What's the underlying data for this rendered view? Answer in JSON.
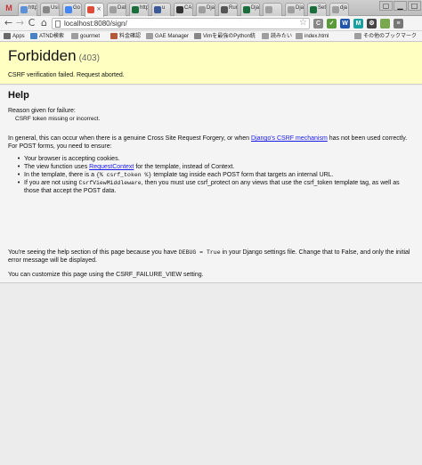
{
  "tabs": [
    {
      "label": "http",
      "color": "#5b8fd6"
    },
    {
      "label": "Usi",
      "color": "#888888"
    },
    {
      "label": "Go",
      "color": "#4285f4"
    },
    {
      "label": "",
      "color": "#dd4b39"
    },
    {
      "label": "Dat",
      "color": "#9e9e9e"
    },
    {
      "label": "http",
      "color": "#1b6e3b"
    },
    {
      "label": "u",
      "color": "#3b5998"
    },
    {
      "label": "CAI",
      "color": "#333333"
    },
    {
      "label": "Dja",
      "color": "#9e9e9e"
    },
    {
      "label": "Run",
      "color": "#555555"
    },
    {
      "label": "Dja",
      "color": "#1b6e3b"
    },
    {
      "label": "",
      "color": "#9e9e9e"
    },
    {
      "label": "Dja",
      "color": "#9e9e9e"
    },
    {
      "label": "Set",
      "color": "#1b6e3b"
    },
    {
      "label": "dja",
      "color": "#9e9e9e"
    }
  ],
  "toolbar": {
    "back": "←",
    "forward": "→",
    "reload": "C",
    "home": "⌂",
    "url": "localhost:8080/sign/",
    "star": "☆",
    "extensions": [
      {
        "label": "C",
        "color": "#888888"
      },
      {
        "label": "✓",
        "color": "#5a9a3a"
      },
      {
        "label": "W",
        "color": "#2255aa"
      },
      {
        "label": "M",
        "color": "#19a1a1"
      },
      {
        "label": "⚙",
        "color": "#444444"
      },
      {
        "label": "",
        "color": "#7aa84e"
      },
      {
        "label": "≡",
        "color": "#777777"
      }
    ]
  },
  "bookmarks": [
    {
      "label": "Apps",
      "color": "#6a6a6a"
    },
    {
      "label": "ATND検索",
      "color": "#4b82c3"
    },
    {
      "label": "gourmet",
      "color": "#9e9e9e"
    },
    {
      "label": "料金確認",
      "color": "#b45a3a"
    },
    {
      "label": "GAE Manager",
      "color": "#9e9e9e"
    },
    {
      "label": "Vimを最強のPython統",
      "color": "#888888"
    },
    {
      "label": "読みたい",
      "color": "#9e9e9e"
    },
    {
      "label": "index.html",
      "color": "#9e9e9e"
    },
    {
      "label": "その他のブックマーク",
      "color": "#9e9e9e"
    }
  ],
  "summary": {
    "title": "Forbidden",
    "code": "(403)",
    "reason": "CSRF verification failed. Request aborted."
  },
  "help": {
    "heading": "Help",
    "reason_label": "Reason given for failure:",
    "reason_value": "CSRF token missing or incorrect.",
    "general_pre": "In general, this can occur when there is a genuine Cross Site Request Forgery, or when",
    "general_link": "Django's CSRF mechanism",
    "general_post": "has not been used correctly. For POST forms, you need to ensure:",
    "items": [
      {
        "text": "Your browser is accepting cookies."
      },
      {
        "pre": "The view function uses",
        "link": "RequestContext",
        "post": "for the template, instead of Context."
      },
      {
        "pre": "In the template, there is a",
        "code": "{% csrf_token %}",
        "post": "template tag inside each POST form that targets an internal URL."
      },
      {
        "pre": "If you are not using",
        "code": "CsrfViewMiddleware",
        "post": ", then you must use csrf_protect on any views that use the csrf_token template tag, as well as those that accept the POST data."
      }
    ],
    "debug_pre": "You're seeing the help section of this page because you have",
    "debug_code": "DEBUG = True",
    "debug_post": "in your Django settings file. Change that to False, and only the initial error message will be displayed.",
    "custom": "You can customize this page using the CSRF_FAILURE_VIEW setting."
  }
}
